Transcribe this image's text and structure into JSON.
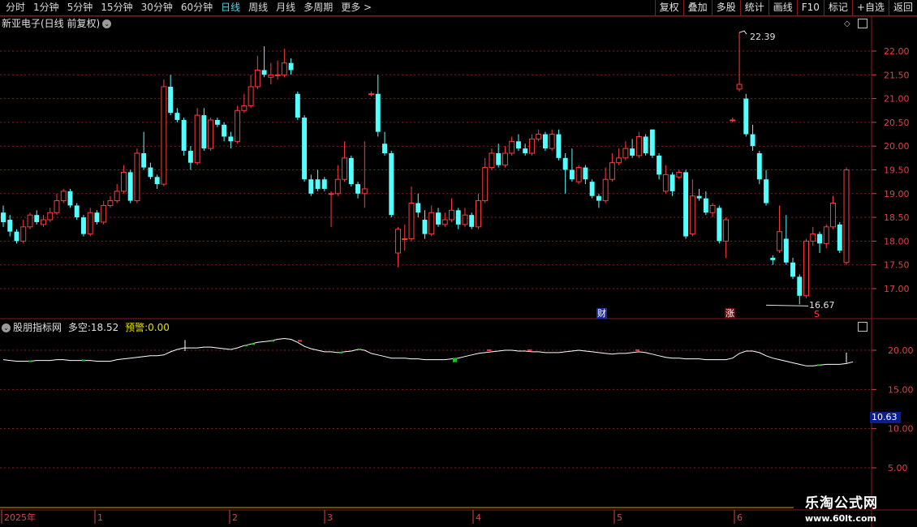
{
  "toolbar": {
    "periods": [
      "分时",
      "1分钟",
      "5分钟",
      "15分钟",
      "30分钟",
      "60分钟",
      "日线",
      "周线",
      "月线",
      "多周期",
      "更多 >"
    ],
    "active_period": "日线",
    "tools": [
      "复权",
      "叠加",
      "多股",
      "统计",
      "画线",
      "F10",
      "标记",
      "+自选",
      "返回"
    ]
  },
  "main": {
    "title": "新亚电子(日线 前复权)",
    "y_ticks": [
      "22.00",
      "21.50",
      "21.00",
      "20.50",
      "20.00",
      "19.50",
      "19.00",
      "18.50",
      "18.00",
      "17.50",
      "17.00"
    ],
    "high_label": "22.39",
    "low_label": "16.67",
    "markers": {
      "cai": "财",
      "zhang": "涨",
      "s": "S"
    }
  },
  "indicator": {
    "name": "股朋指标网",
    "duokong_label": "多空:",
    "duokong_value": "18.52",
    "yujing_label": "预警:",
    "yujing_value": "0.00",
    "y_ticks": [
      "20.00",
      "15.00",
      "10.00",
      "5.00"
    ],
    "current_badge": "10.63"
  },
  "time_axis": [
    "2025年",
    "1",
    "2",
    "3",
    "4",
    "5",
    "6"
  ],
  "watermark": {
    "line1": "乐淘公式网",
    "line2": "www.60lt.com"
  },
  "colors": {
    "up": "#ff3b3b",
    "down": "#54ffff",
    "line": "#ffffff",
    "grid": "#8a1a1a",
    "warn_text": "#e0e000"
  },
  "chart_data": {
    "type": "candlestick",
    "ylim": [
      16.5,
      22.6
    ],
    "candles": [
      [
        18.6,
        18.4,
        18.75,
        18.3
      ],
      [
        18.45,
        18.2,
        18.55,
        18.1
      ],
      [
        18.2,
        18.0,
        18.25,
        17.95
      ],
      [
        18.0,
        18.3,
        18.45,
        17.95
      ],
      [
        18.3,
        18.55,
        18.6,
        18.25
      ],
      [
        18.55,
        18.4,
        18.65,
        18.35
      ],
      [
        18.35,
        18.45,
        18.55,
        18.3
      ],
      [
        18.45,
        18.6,
        18.7,
        18.4
      ],
      [
        18.6,
        18.85,
        19.0,
        18.55
      ],
      [
        18.85,
        19.05,
        19.1,
        18.8
      ],
      [
        19.05,
        18.75,
        19.1,
        18.7
      ],
      [
        18.75,
        18.5,
        18.8,
        18.45
      ],
      [
        18.5,
        18.15,
        18.55,
        18.1
      ],
      [
        18.15,
        18.6,
        18.7,
        18.1
      ],
      [
        18.6,
        18.4,
        18.65,
        18.35
      ],
      [
        18.4,
        18.75,
        18.85,
        18.35
      ],
      [
        18.75,
        18.85,
        18.95,
        18.7
      ],
      [
        18.85,
        19.05,
        19.2,
        18.8
      ],
      [
        19.05,
        19.45,
        19.6,
        19.0
      ],
      [
        19.45,
        18.85,
        19.5,
        18.8
      ],
      [
        18.85,
        19.85,
        19.95,
        18.8
      ],
      [
        19.85,
        19.55,
        20.3,
        19.5
      ],
      [
        19.55,
        19.35,
        19.65,
        19.3
      ],
      [
        19.35,
        19.2,
        19.4,
        19.1
      ],
      [
        19.2,
        21.25,
        21.4,
        19.15
      ],
      [
        21.25,
        20.7,
        21.5,
        20.65
      ],
      [
        20.7,
        20.55,
        20.8,
        20.5
      ],
      [
        20.55,
        19.9,
        20.6,
        19.8
      ],
      [
        19.9,
        19.65,
        20.0,
        19.5
      ],
      [
        19.65,
        20.65,
        20.8,
        19.6
      ],
      [
        20.65,
        19.95,
        20.8,
        19.9
      ],
      [
        19.95,
        20.55,
        20.6,
        19.9
      ],
      [
        20.55,
        20.45,
        20.6,
        20.4
      ],
      [
        20.45,
        20.2,
        20.5,
        20.1
      ],
      [
        20.2,
        20.1,
        20.3,
        19.95
      ],
      [
        20.1,
        20.75,
        20.85,
        20.05
      ],
      [
        20.75,
        20.85,
        21.1,
        20.7
      ],
      [
        20.85,
        21.25,
        21.5,
        20.8
      ],
      [
        21.25,
        21.6,
        21.9,
        21.2
      ],
      [
        21.6,
        21.5,
        22.1,
        21.45
      ],
      [
        21.45,
        21.5,
        21.75,
        21.3
      ],
      [
        21.5,
        21.5,
        21.8,
        21.4
      ],
      [
        21.5,
        21.75,
        22.05,
        21.45
      ],
      [
        21.75,
        21.6,
        21.85,
        21.5
      ],
      [
        21.1,
        20.6,
        21.15,
        20.55
      ],
      [
        20.6,
        19.3,
        20.65,
        19.25
      ],
      [
        19.3,
        19.0,
        19.4,
        18.95
      ],
      [
        19.3,
        19.1,
        19.5,
        19.05
      ],
      [
        19.3,
        19.1,
        19.35,
        19.05
      ],
      [
        19.0,
        19.0,
        19.05,
        18.3
      ],
      [
        19.0,
        19.3,
        19.6,
        18.95
      ],
      [
        19.3,
        19.75,
        20.1,
        19.25
      ],
      [
        19.75,
        19.2,
        19.8,
        19.15
      ],
      [
        19.2,
        19.0,
        19.25,
        18.9
      ],
      [
        19.0,
        19.1,
        20.1,
        18.7
      ],
      [
        21.1,
        21.1,
        21.15,
        21.05
      ],
      [
        21.1,
        20.3,
        21.5,
        20.2
      ],
      [
        20.05,
        19.85,
        20.3,
        19.8
      ],
      [
        19.85,
        18.55,
        19.9,
        18.5
      ],
      [
        17.75,
        18.25,
        18.3,
        17.45
      ],
      [
        18.05,
        18.05,
        18.35,
        17.8
      ],
      [
        18.05,
        18.8,
        19.15,
        18.0
      ],
      [
        18.8,
        18.6,
        19.0,
        18.5
      ],
      [
        18.45,
        18.15,
        18.65,
        18.05
      ],
      [
        18.15,
        18.6,
        18.75,
        18.1
      ],
      [
        18.6,
        18.35,
        18.7,
        18.3
      ],
      [
        18.35,
        18.45,
        18.6,
        18.3
      ],
      [
        18.45,
        18.65,
        18.9,
        18.4
      ],
      [
        18.65,
        18.35,
        18.7,
        18.25
      ],
      [
        18.35,
        18.55,
        18.7,
        18.3
      ],
      [
        18.55,
        18.3,
        18.6,
        18.25
      ],
      [
        18.3,
        18.85,
        19.0,
        18.25
      ],
      [
        18.85,
        19.55,
        19.75,
        18.8
      ],
      [
        19.55,
        19.85,
        19.95,
        19.5
      ],
      [
        19.85,
        19.6,
        20.05,
        19.55
      ],
      [
        19.6,
        19.85,
        20.0,
        19.55
      ],
      [
        19.85,
        20.1,
        20.2,
        19.8
      ],
      [
        20.1,
        19.95,
        20.25,
        19.9
      ],
      [
        19.95,
        19.85,
        20.05,
        19.8
      ],
      [
        19.85,
        20.15,
        20.25,
        19.8
      ],
      [
        20.15,
        20.25,
        20.35,
        20.1
      ],
      [
        20.25,
        19.95,
        20.3,
        19.9
      ],
      [
        19.95,
        20.25,
        20.35,
        19.9
      ],
      [
        20.25,
        19.75,
        20.35,
        19.7
      ],
      [
        19.75,
        19.5,
        19.85,
        19.0
      ],
      [
        19.5,
        19.3,
        19.95,
        19.25
      ],
      [
        19.25,
        19.55,
        19.6,
        19.2
      ],
      [
        19.55,
        19.3,
        19.6,
        19.2
      ],
      [
        19.25,
        18.95,
        19.3,
        18.9
      ],
      [
        18.95,
        18.85,
        19.0,
        18.7
      ],
      [
        18.85,
        19.3,
        19.55,
        18.8
      ],
      [
        19.3,
        19.65,
        19.85,
        19.25
      ],
      [
        19.65,
        19.75,
        19.95,
        19.6
      ],
      [
        19.75,
        19.95,
        20.1,
        19.7
      ],
      [
        19.95,
        19.8,
        20.15,
        19.75
      ],
      [
        19.8,
        20.2,
        20.3,
        19.75
      ],
      [
        20.2,
        19.85,
        20.25,
        19.8
      ],
      [
        20.35,
        19.8,
        20.35,
        19.75
      ],
      [
        19.8,
        19.4,
        19.85,
        19.3
      ],
      [
        19.05,
        19.4,
        19.6,
        19.0
      ],
      [
        19.4,
        19.05,
        19.45,
        18.95
      ],
      [
        19.35,
        19.45,
        19.5,
        19.3
      ],
      [
        19.45,
        18.1,
        19.5,
        18.05
      ],
      [
        18.15,
        18.95,
        19.3,
        18.1
      ],
      [
        18.95,
        18.9,
        19.1,
        18.85
      ],
      [
        18.9,
        18.6,
        19.05,
        18.55
      ],
      [
        18.6,
        18.75,
        18.8,
        18.5
      ],
      [
        18.7,
        18.0,
        18.75,
        17.95
      ],
      [
        18.0,
        18.45,
        18.5,
        17.65
      ],
      [
        20.55,
        20.55,
        20.6,
        20.5
      ],
      [
        21.2,
        21.3,
        22.39,
        21.15
      ],
      [
        21.0,
        20.25,
        21.1,
        20.2
      ],
      [
        20.25,
        20.0,
        20.45,
        19.9
      ],
      [
        19.85,
        19.3,
        19.9,
        19.2
      ],
      [
        19.3,
        18.8,
        19.5,
        18.75
      ],
      [
        17.65,
        17.6,
        17.7,
        17.5
      ],
      [
        17.8,
        18.2,
        18.75,
        17.75
      ],
      [
        18.05,
        17.55,
        18.55,
        17.5
      ],
      [
        17.55,
        17.25,
        17.65,
        17.2
      ],
      [
        17.25,
        16.85,
        17.3,
        16.67
      ],
      [
        16.85,
        18.0,
        18.05,
        16.8
      ],
      [
        18.0,
        18.15,
        18.3,
        17.9
      ],
      [
        18.15,
        17.95,
        18.2,
        17.75
      ],
      [
        17.95,
        18.3,
        18.35,
        17.85
      ],
      [
        18.3,
        18.8,
        18.95,
        18.25
      ],
      [
        18.35,
        17.8,
        18.4,
        17.75
      ],
      [
        17.55,
        19.5,
        19.55,
        17.5
      ]
    ],
    "indicator": {
      "name": "多空",
      "ylim": [
        2.5,
        24
      ],
      "values": [
        18.8,
        18.7,
        18.6,
        18.6,
        18.6,
        18.7,
        18.7,
        18.7,
        18.8,
        18.8,
        18.7,
        18.7,
        18.7,
        18.7,
        18.6,
        18.6,
        18.6,
        18.8,
        18.9,
        19.0,
        19.1,
        19.2,
        19.3,
        19.3,
        19.4,
        19.8,
        20.1,
        20.3,
        20.3,
        20.3,
        20.4,
        20.4,
        20.3,
        20.2,
        20.1,
        20.3,
        20.6,
        20.8,
        21.0,
        21.1,
        21.2,
        21.4,
        21.5,
        21.4,
        21.0,
        20.5,
        20.2,
        20.0,
        19.8,
        19.8,
        19.7,
        19.8,
        19.9,
        20.1,
        20.0,
        19.6,
        19.4,
        19.2,
        19.0,
        19.0,
        19.0,
        18.9,
        18.9,
        18.8,
        18.8,
        18.8,
        18.8,
        18.9,
        19.0,
        19.2,
        19.4,
        19.6,
        19.7,
        19.8,
        19.9,
        20.0,
        20.0,
        19.9,
        19.9,
        19.8,
        19.8,
        19.7,
        19.7,
        19.7,
        19.8,
        19.9,
        20.0,
        19.9,
        19.8,
        19.7,
        19.6,
        19.5,
        19.6,
        19.6,
        19.7,
        19.8,
        19.7,
        19.5,
        19.3,
        19.1,
        19.0,
        19.0,
        18.9,
        18.9,
        18.9,
        18.8,
        18.8,
        18.8,
        18.8,
        19.0,
        19.6,
        19.9,
        19.9,
        19.7,
        19.3,
        19.0,
        18.8,
        18.6,
        18.4,
        18.2,
        18.0,
        18.0,
        18.1,
        18.2,
        18.2,
        18.2,
        18.3,
        18.52
      ]
    }
  }
}
